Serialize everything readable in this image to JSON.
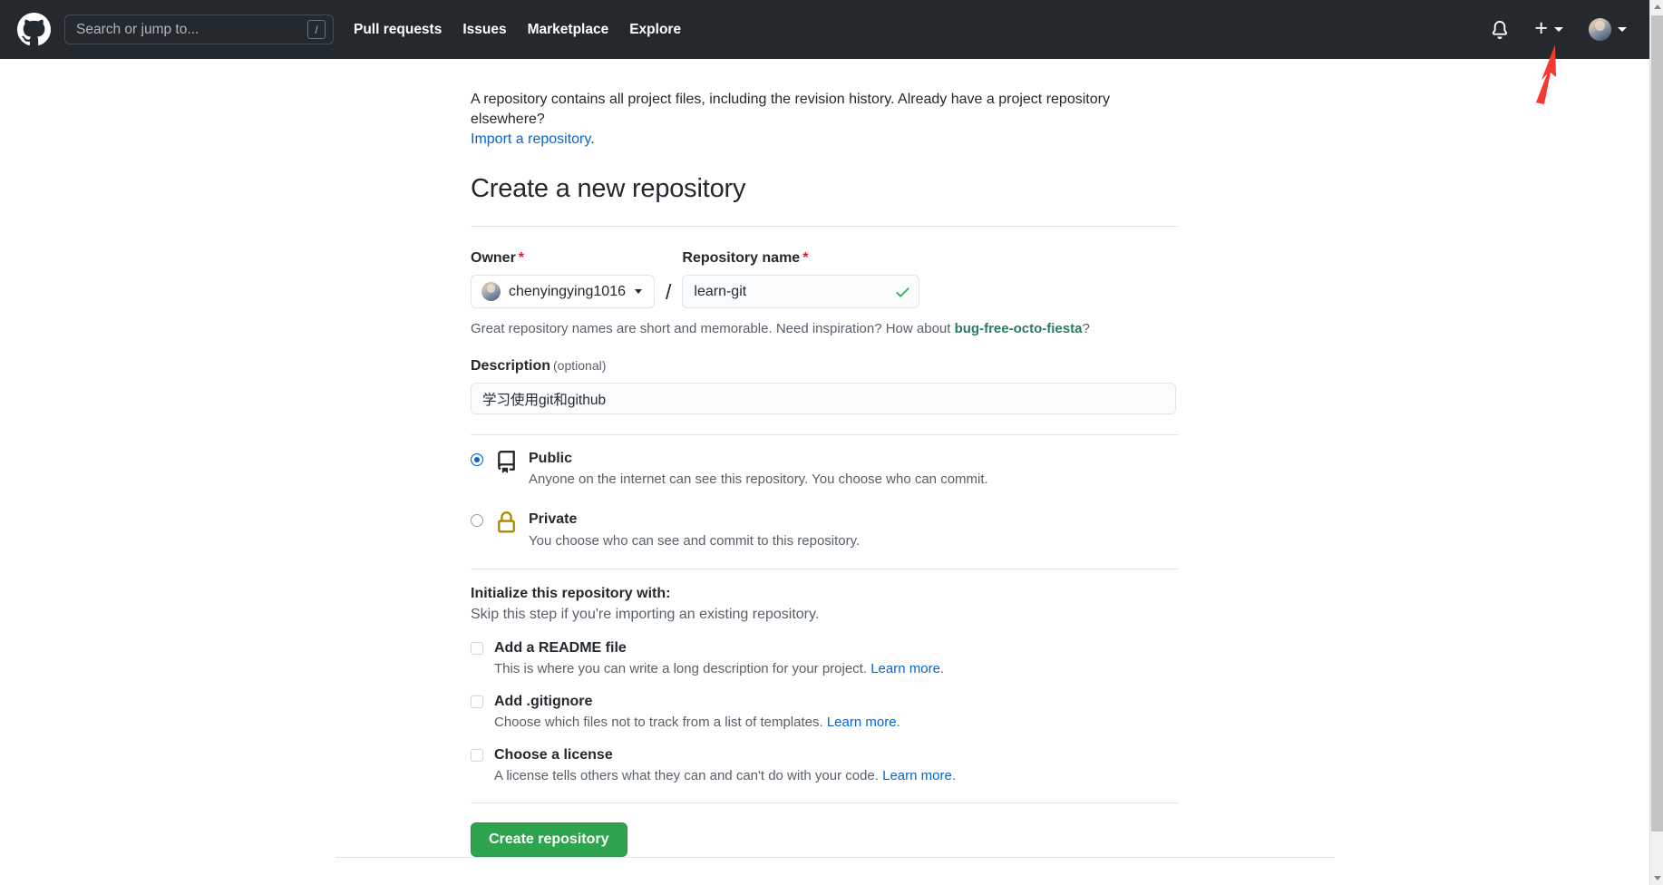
{
  "header": {
    "logo_icon": "github-mark-icon",
    "search": {
      "placeholder": "Search or jump to...",
      "value": "",
      "shortcut_badge": "/"
    },
    "nav": [
      {
        "label": "Pull requests"
      },
      {
        "label": "Issues"
      },
      {
        "label": "Marketplace"
      },
      {
        "label": "Explore"
      }
    ],
    "notifications_icon": "bell-icon",
    "create_new_icon": "plus-icon",
    "account_icon": "avatar",
    "background_color": "#24292e"
  },
  "annotation": {
    "type": "arrow",
    "color": "#f4392f",
    "points_to": "create-new-plus-button"
  },
  "main": {
    "intro_text": "A repository contains all project files, including the revision history. Already have a project repository elsewhere?",
    "import_link": "Import a repository",
    "import_link_trailing": ".",
    "title": "Create a new repository",
    "owner": {
      "label": "Owner",
      "required_mark": "*",
      "selected": "chenyingying1016"
    },
    "repo_name": {
      "label": "Repository name",
      "required_mark": "*",
      "value": "learn-git",
      "placeholder": "",
      "valid_icon": "green-check-icon"
    },
    "name_hint_prefix": "Great repository names are short and memorable. Need inspiration? How about ",
    "name_hint_suggestion": "bug-free-octo-fiesta",
    "name_hint_suffix": "?",
    "description": {
      "label": "Description",
      "optional_note": "(optional)",
      "value": "学习使用git和github",
      "placeholder": ""
    },
    "visibility": [
      {
        "id": "public",
        "title": "Public",
        "description": "Anyone on the internet can see this repository. You choose who can commit.",
        "selected": true,
        "icon": "repo-book-icon"
      },
      {
        "id": "private",
        "title": "Private",
        "description": "You choose who can see and commit to this repository.",
        "selected": false,
        "icon": "lock-icon"
      }
    ],
    "initialize": {
      "title": "Initialize this repository with:",
      "subtitle": "Skip this step if you're importing an existing repository.",
      "options": [
        {
          "label": "Add a README file",
          "description": "This is where you can write a long description for your project. ",
          "link": "Learn more",
          "link_suffix": ".",
          "checked": false
        },
        {
          "label": "Add .gitignore",
          "description": "Choose which files not to track from a list of templates. ",
          "link": "Learn more",
          "link_suffix": ".",
          "checked": false
        },
        {
          "label": "Choose a license",
          "description": "A license tells others what they can and can't do with your code. ",
          "link": "Learn more",
          "link_suffix": ".",
          "checked": false
        }
      ]
    },
    "submit_label": "Create repository"
  },
  "colors": {
    "header_bg": "#24292e",
    "link_blue": "#0366d6",
    "green_button": "#2ea44f",
    "required_red": "#cb2431",
    "suggestion_green": "#2c7a5e",
    "lock_gold": "#b08800",
    "annotation_red": "#f4392f"
  },
  "scrollbar": {
    "visible": true,
    "position": "right"
  }
}
